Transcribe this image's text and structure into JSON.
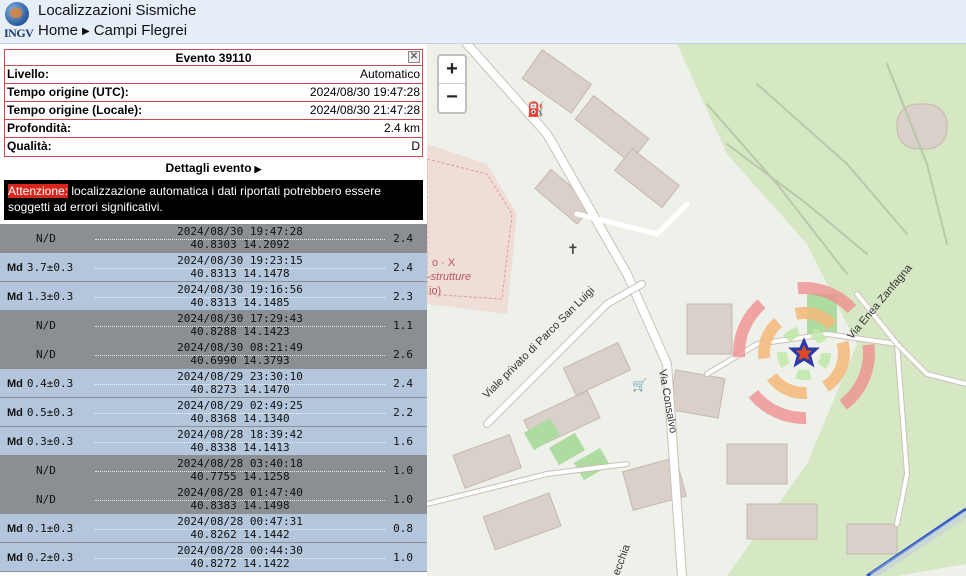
{
  "header": {
    "logo_text": "INGV",
    "title": "Localizzazioni Sismiche",
    "breadcrumb": [
      "Home",
      "Campi Flegrei"
    ]
  },
  "event": {
    "title": "Evento 39110",
    "fields": [
      {
        "label": "Livello:",
        "value": "Automatico"
      },
      {
        "label": "Tempo origine (UTC):",
        "value": "2024/08/30 19:47:28"
      },
      {
        "label": "Tempo origine (Locale):",
        "value": "2024/08/30 21:47:28"
      },
      {
        "label": "Profondità:",
        "value": "2.4 km"
      },
      {
        "label": "Qualità:",
        "value": "D"
      }
    ],
    "details_link": "Dettagli evento",
    "warning_tag": "Attenzione:",
    "warning_text": " localizzazione automatica i dati riportati potrebbero essere soggetti ad errori significativi."
  },
  "events": [
    {
      "type": "auto",
      "mag_label": "",
      "mag": "N/D",
      "datetime": "2024/08/30 19:47:28",
      "coords": "40.8303 14.2092",
      "depth": "2.4"
    },
    {
      "type": "manual",
      "mag_label": "Md",
      "mag": "3.7±0.3",
      "datetime": "2024/08/30 19:23:15",
      "coords": "40.8313 14.1478",
      "depth": "2.4"
    },
    {
      "type": "manual",
      "mag_label": "Md",
      "mag": "1.3±0.3",
      "datetime": "2024/08/30 19:16:56",
      "coords": "40.8313 14.1485",
      "depth": "2.3"
    },
    {
      "type": "auto",
      "mag_label": "",
      "mag": "N/D",
      "datetime": "2024/08/30 17:29:43",
      "coords": "40.8288 14.1423",
      "depth": "1.1"
    },
    {
      "type": "auto",
      "mag_label": "",
      "mag": "N/D",
      "datetime": "2024/08/30 08:21:49",
      "coords": "40.6990 14.3793",
      "depth": "2.6"
    },
    {
      "type": "manual",
      "mag_label": "Md",
      "mag": "0.4±0.3",
      "datetime": "2024/08/29 23:30:10",
      "coords": "40.8273 14.1470",
      "depth": "2.4"
    },
    {
      "type": "manual",
      "mag_label": "Md",
      "mag": "0.5±0.3",
      "datetime": "2024/08/29 02:49:25",
      "coords": "40.8368 14.1340",
      "depth": "2.2"
    },
    {
      "type": "manual",
      "mag_label": "Md",
      "mag": "0.3±0.3",
      "datetime": "2024/08/28 18:39:42",
      "coords": "40.8338 14.1413",
      "depth": "1.6"
    },
    {
      "type": "auto",
      "mag_label": "",
      "mag": "N/D",
      "datetime": "2024/08/28 03:40:18",
      "coords": "40.7755 14.1258",
      "depth": "1.0"
    },
    {
      "type": "auto",
      "mag_label": "",
      "mag": "N/D",
      "datetime": "2024/08/28 01:47:40",
      "coords": "40.8383 14.1498",
      "depth": "1.0"
    },
    {
      "type": "manual",
      "mag_label": "Md",
      "mag": "0.1±0.3",
      "datetime": "2024/08/28 00:47:31",
      "coords": "40.8262 14.1442",
      "depth": "0.8"
    },
    {
      "type": "manual",
      "mag_label": "Md",
      "mag": "0.2±0.3",
      "datetime": "2024/08/28 00:44:30",
      "coords": "40.8272 14.1422",
      "depth": "1.0"
    }
  ],
  "map": {
    "zoom_in": "+",
    "zoom_out": "−",
    "street_labels": [
      "Viale privato di Parco San Luigi",
      "Via Consalvo",
      "Via Enea Zanfagna",
      "-strutture",
      "o · X",
      "io)",
      "ecchia"
    ],
    "colors": {
      "ring_inner": "#f4b97a",
      "ring_outer": "#ef8a8a",
      "star": "#2a3aa8",
      "star_center": "#e04a20"
    }
  }
}
